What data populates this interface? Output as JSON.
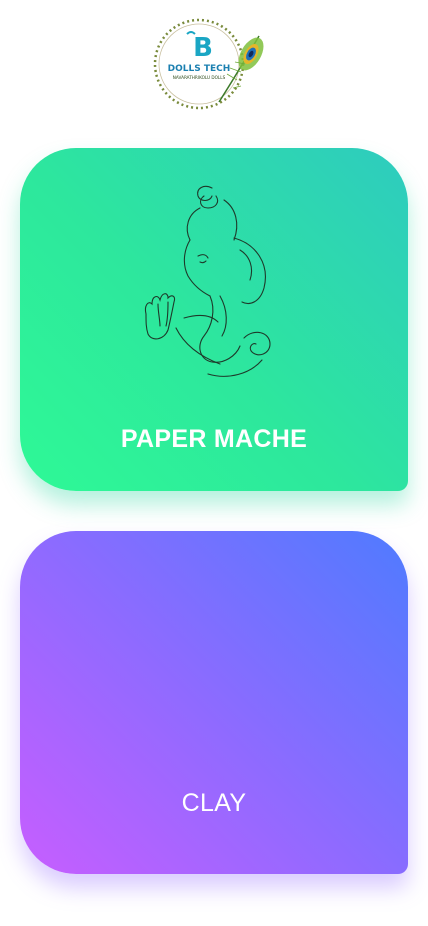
{
  "header": {
    "logo_title": "DOLLS TECH",
    "logo_subtitle": "NAVARATHRIKOLU DOLLS",
    "logo_icon": "peacock-feather-b-logo"
  },
  "categories": [
    {
      "label": "PAPER MACHE",
      "icon": "ganesha-sketch-icon",
      "gradient": [
        "#2ef996",
        "#2ecbbf"
      ]
    },
    {
      "label": "CLAY",
      "gradient": [
        "#c75eff",
        "#4f7bff"
      ]
    }
  ]
}
